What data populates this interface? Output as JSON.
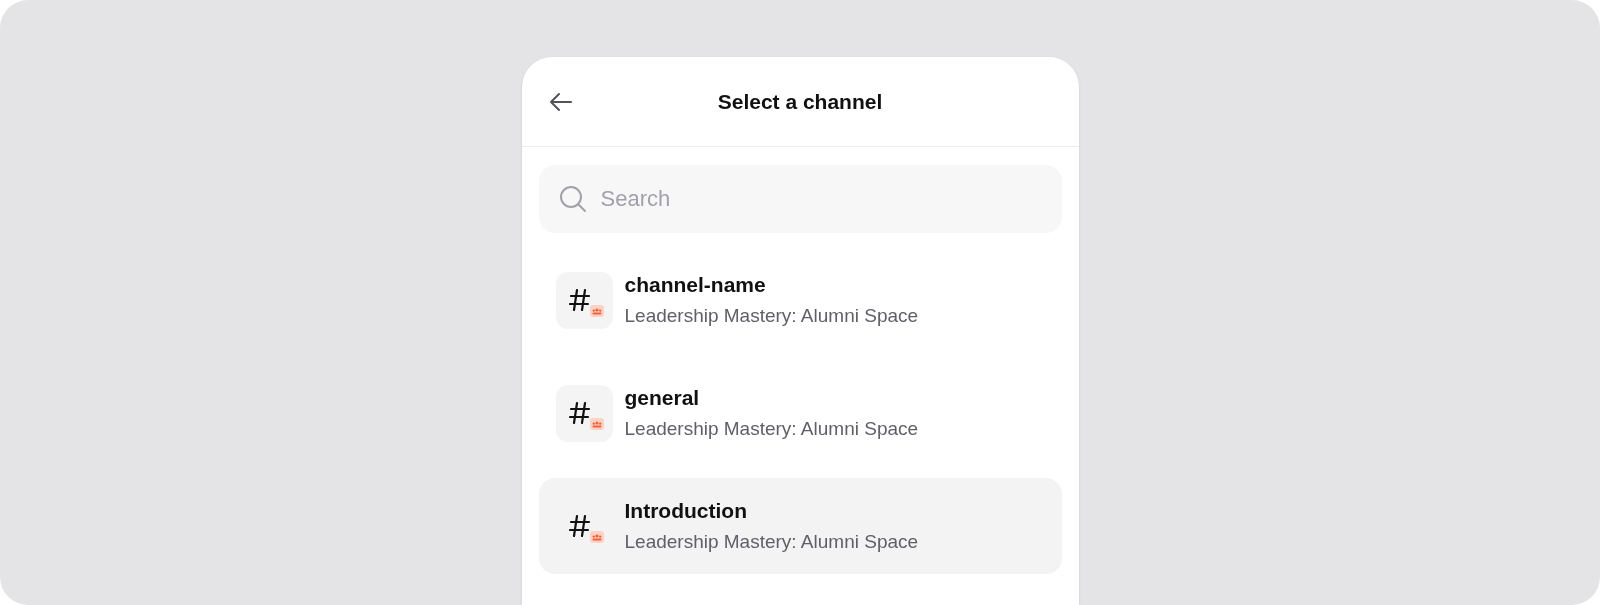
{
  "header": {
    "title": "Select a channel"
  },
  "search": {
    "placeholder": "Search"
  },
  "channels": [
    {
      "name": "channel-name",
      "space": "Leadership Mastery: Alumni Space",
      "selected": false
    },
    {
      "name": "general",
      "space": "Leadership Mastery: Alumni Space",
      "selected": false
    },
    {
      "name": "Introduction",
      "space": "Leadership Mastery: Alumni Space",
      "selected": true
    }
  ]
}
